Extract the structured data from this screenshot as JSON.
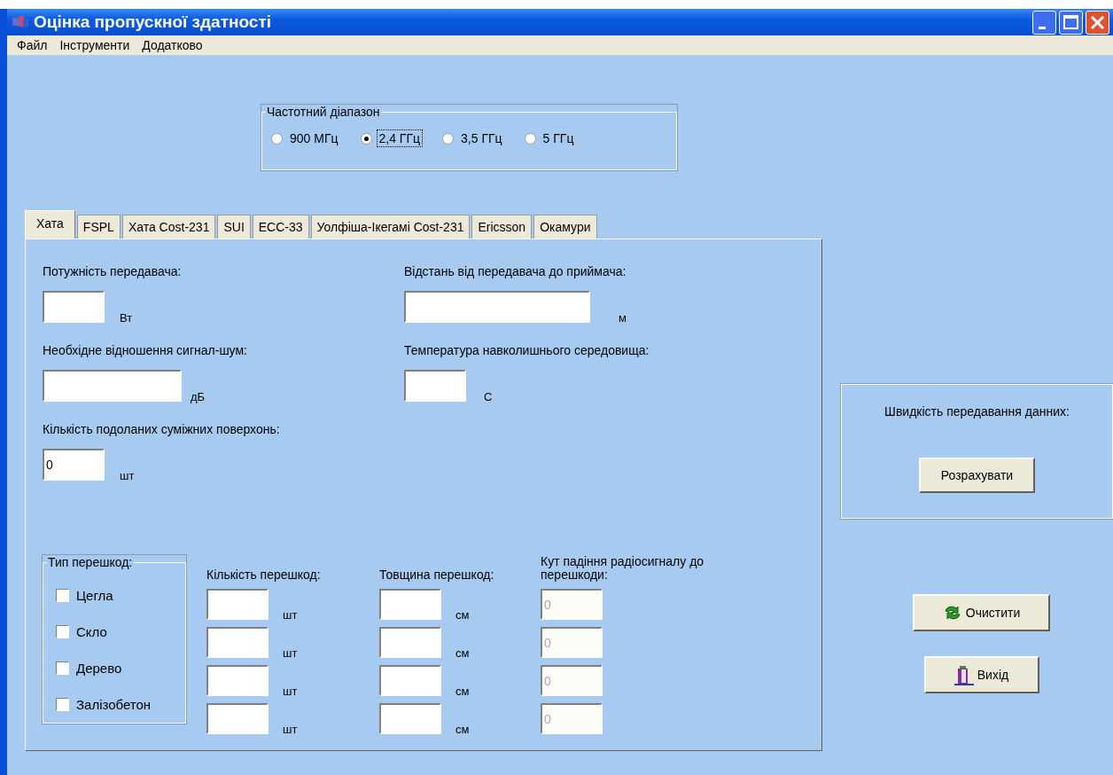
{
  "window": {
    "title": "Оцінка пропускної здатності"
  },
  "menu": [
    "Файл",
    "Інструменти",
    "Додатково"
  ],
  "frequency_band": {
    "label": "Частотний діапазон",
    "options": [
      {
        "label": "900 МГц",
        "selected": false
      },
      {
        "label": "2,4 ГГц",
        "selected": true
      },
      {
        "label": "3,5 ГГц",
        "selected": false
      },
      {
        "label": "5 ГГц",
        "selected": false
      }
    ]
  },
  "tabs": [
    {
      "label": "Хата",
      "selected": true
    },
    {
      "label": "FSPL",
      "selected": false
    },
    {
      "label": "Хата Cost-231",
      "selected": false
    },
    {
      "label": "SUI",
      "selected": false
    },
    {
      "label": "ECC-33",
      "selected": false
    },
    {
      "label": "Уолфіша-Ікегамі Cost-231",
      "selected": false
    },
    {
      "label": "Ericsson",
      "selected": false
    },
    {
      "label": "Окамури",
      "selected": false
    }
  ],
  "fields": [
    {
      "label": "Потужність передавача:",
      "unit": "Вт"
    },
    {
      "label": "Відстань від передавача до приймача:",
      "unit": "м"
    },
    {
      "label": "Необхідне відношення сигнал-шум:",
      "unit": "дБ"
    },
    {
      "label": "Температура навколишнього середовища:",
      "unit": "С"
    },
    {
      "label": "Кількість подоланих суміжних поверхонь:",
      "value": "0",
      "unit": "шт"
    }
  ],
  "obstacles": {
    "type_label": "Тип перешкод:",
    "count_label": "Кількість перешкод:",
    "thickness_label": "Товщина перешкод:",
    "angle_label": "Кут падіння радіосигналу до перешкоди:",
    "rows": [
      {
        "material": "Цегла",
        "checked": false,
        "count_unit": "шт",
        "thickness_unit": "см",
        "angle": "0",
        "angle_disabled": true
      },
      {
        "material": "Скло",
        "checked": false,
        "count_unit": "шт",
        "thickness_unit": "см",
        "angle": "0",
        "angle_disabled": true
      },
      {
        "material": "Дерево",
        "checked": false,
        "count_unit": "шт",
        "thickness_unit": "см",
        "angle": "0",
        "angle_disabled": true
      },
      {
        "material": "Залізобетон",
        "checked": false,
        "count_unit": "шт",
        "thickness_unit": "см",
        "angle": "0",
        "angle_disabled": true
      }
    ]
  },
  "result": {
    "label": "Швидкість передавання данних:",
    "button": "Розрахувати"
  },
  "buttons": [
    {
      "label": "Очистити",
      "kind": "refresh"
    },
    {
      "label": "Вихід",
      "kind": "exit"
    }
  ]
}
